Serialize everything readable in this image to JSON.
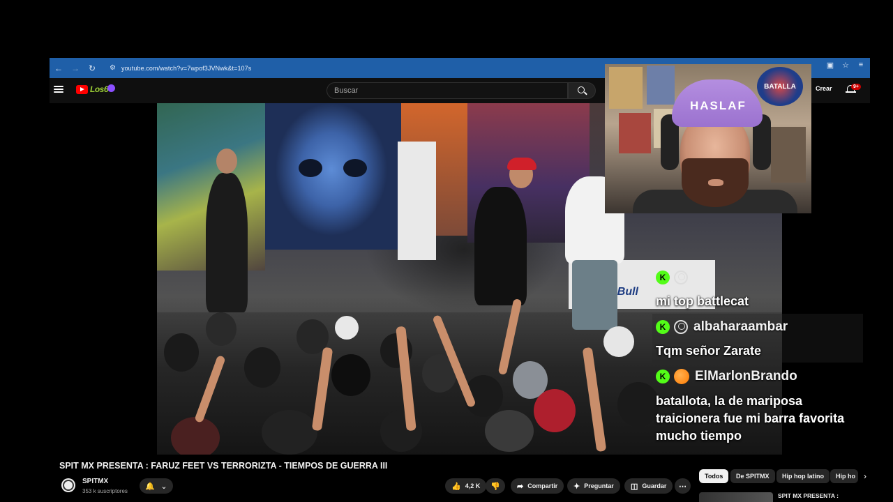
{
  "browser": {
    "url": "youtube.com/watch?v=7wpof3JVNwk&t=107s"
  },
  "header": {
    "search_placeholder": "Buscar",
    "create_label": "Crear",
    "notifications_badge": "9+"
  },
  "webcam": {
    "cap_text": "HASLAF"
  },
  "video": {
    "banner_text": "dBull"
  },
  "chat": {
    "messages": [
      {
        "user": "",
        "text": "mi top battlecat"
      },
      {
        "user": "albaharaambar",
        "text": "Tqm señor Zarate"
      },
      {
        "user": "ElMarlonBrando",
        "text": "batallota, la de mariposa traicionera fue mi barra favorita mucho tiempo"
      }
    ]
  },
  "info": {
    "title": "SPIT MX PRESENTA : FARUZ FEET VS TERRORIZTA - TIEMPOS DE GUERRA III",
    "channel": "SPITMX",
    "subscribers": "353 k suscriptores",
    "likes": "4,2 K",
    "share": "Compartir",
    "ask": "Preguntar",
    "save": "Guardar"
  },
  "chips": [
    "Todos",
    "De SPITMX",
    "Hip hop latino",
    "Hip ho"
  ],
  "recommended": {
    "title": "SPIT MX PRESENTA :"
  },
  "colors": {
    "browser_bar": "#1f5fa8",
    "yt_bg": "#0f0f0f",
    "kick_green": "#53fc18"
  }
}
